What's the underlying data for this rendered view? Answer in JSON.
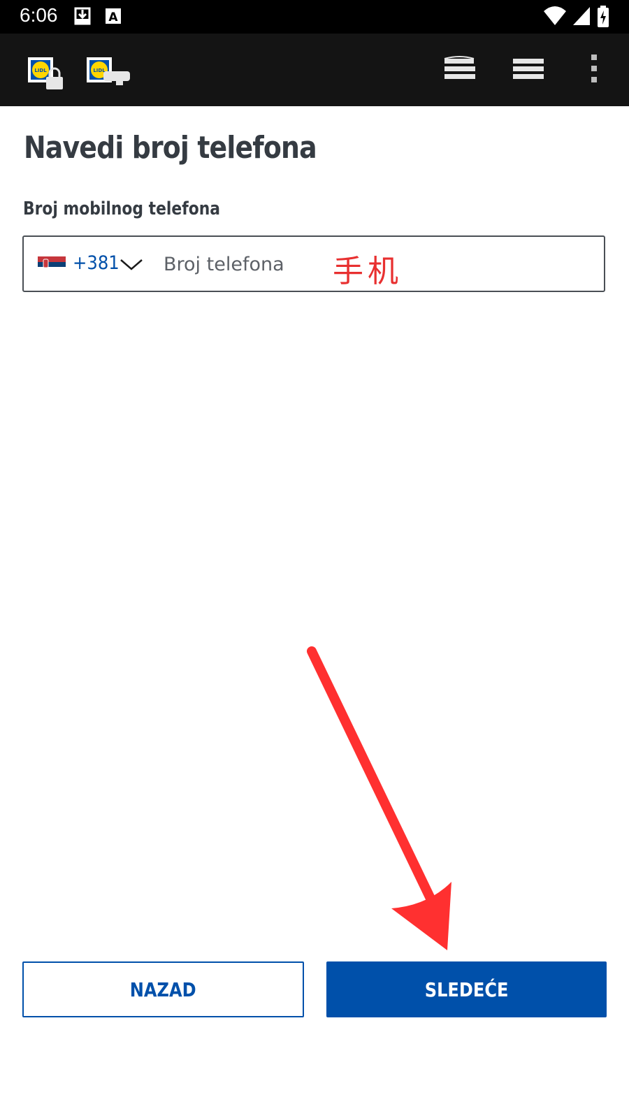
{
  "status_bar": {
    "time": "6:06",
    "icons": [
      "download-notification-icon",
      "font-a-icon",
      "wifi-icon",
      "cellular-signal-icon",
      "battery-charging-icon"
    ]
  },
  "toolbar": {
    "left_icons": [
      "lidl-lock-icon",
      "lidl-key-icon"
    ],
    "right_icons": [
      "stack-layers-icon",
      "list-menu-icon",
      "overflow-menu-icon"
    ]
  },
  "page": {
    "title": "Navedi broj telefona",
    "phone_label": "Broj mobilnog telefona",
    "country_code": "+381",
    "country_flag": "serbia-flag-icon",
    "phone_placeholder": "Broj telefona",
    "phone_value": "",
    "annotation_text": "手机"
  },
  "buttons": {
    "back_label": "NAZAD",
    "next_label": "SLEDEĆE"
  },
  "colors": {
    "brand_blue": "#0050aa",
    "annotation_red": "#e83030",
    "text_dark": "#353b42",
    "toolbar_bg": "#141414"
  }
}
